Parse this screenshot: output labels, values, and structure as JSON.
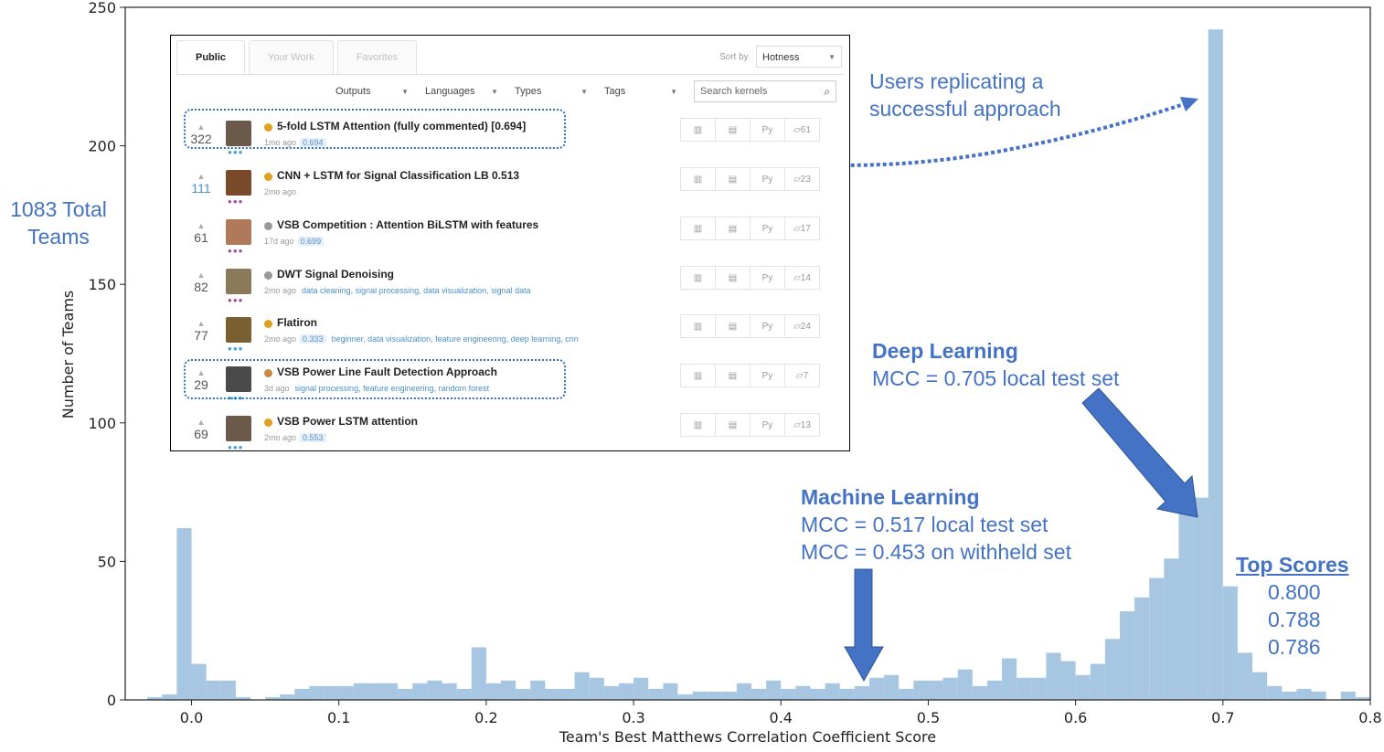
{
  "chart_data": {
    "type": "bar",
    "xlabel": "Team's Best Matthews Correlation Coefficient Score",
    "ylabel": "Number of Teams",
    "xlim": [
      -0.045,
      0.8
    ],
    "ylim": [
      0,
      250
    ],
    "bin_width": 0.01,
    "color": "#A6C6E2",
    "x_ticks": [
      "0.0",
      "0.1",
      "0.2",
      "0.3",
      "0.4",
      "0.5",
      "0.6",
      "0.7",
      "0.8"
    ],
    "y_ticks": [
      "0",
      "50",
      "100",
      "150",
      "200",
      "250"
    ],
    "bin_starts": [
      -0.03,
      -0.02,
      -0.01,
      0.0,
      0.01,
      0.02,
      0.03,
      0.04,
      0.05,
      0.06,
      0.07,
      0.08,
      0.09,
      0.1,
      0.11,
      0.12,
      0.13,
      0.14,
      0.15,
      0.16,
      0.17,
      0.18,
      0.19,
      0.2,
      0.21,
      0.22,
      0.23,
      0.24,
      0.25,
      0.26,
      0.27,
      0.28,
      0.29,
      0.3,
      0.31,
      0.32,
      0.33,
      0.34,
      0.35,
      0.36,
      0.37,
      0.38,
      0.39,
      0.4,
      0.41,
      0.42,
      0.43,
      0.44,
      0.45,
      0.46,
      0.47,
      0.48,
      0.49,
      0.5,
      0.51,
      0.52,
      0.53,
      0.54,
      0.55,
      0.56,
      0.57,
      0.58,
      0.59,
      0.6,
      0.61,
      0.62,
      0.63,
      0.64,
      0.65,
      0.66,
      0.67,
      0.68,
      0.69,
      0.7,
      0.71,
      0.72,
      0.73,
      0.74,
      0.75,
      0.76,
      0.77,
      0.78,
      0.79
    ],
    "values": [
      1,
      2,
      62,
      13,
      7,
      7,
      1,
      0,
      1,
      2,
      4,
      5,
      5,
      5,
      6,
      6,
      6,
      4,
      6,
      7,
      6,
      4,
      19,
      6,
      7,
      4,
      7,
      4,
      4,
      10,
      8,
      5,
      6,
      8,
      4,
      6,
      2,
      3,
      3,
      3,
      6,
      4,
      7,
      4,
      5,
      4,
      6,
      4,
      5,
      8,
      9,
      4,
      7,
      7,
      8,
      11,
      5,
      7,
      15,
      8,
      8,
      17,
      14,
      9,
      13,
      22,
      32,
      37,
      44,
      51,
      70,
      73,
      242,
      41,
      17,
      10,
      5,
      3,
      4,
      3,
      0,
      3,
      1
    ]
  },
  "axes": {
    "x_ticks": [
      "0.0",
      "0.1",
      "0.2",
      "0.3",
      "0.4",
      "0.5",
      "0.6",
      "0.7",
      "0.8"
    ],
    "y_ticks": [
      "0",
      "50",
      "100",
      "150",
      "200",
      "250"
    ],
    "xlabel": "Team's Best Matthews Correlation Coefficient Score",
    "ylabel": "Number of Teams"
  },
  "annotations": {
    "total_teams": "1083 Total Teams",
    "replicating": "Users replicating a successful approach",
    "deep_learning_title": "Deep Learning",
    "deep_learning_mcc": "MCC = 0.705 local test set",
    "ml_title": "Machine Learning",
    "ml_mcc_local": "MCC = 0.517 local test set",
    "ml_mcc_withheld": "MCC = 0.453 on withheld set",
    "top_scores_title": "Top Scores",
    "top_scores": [
      "0.800",
      "0.788",
      "0.786"
    ],
    "accent_color": "#4472C4",
    "arrow_color": "#4472C4"
  },
  "inset": {
    "tabs": [
      "Public",
      "Your Work",
      "Favorites"
    ],
    "sort_label": "Sort by",
    "sort_value": "Hotness",
    "filters": [
      "Outputs",
      "Languages",
      "Types",
      "Tags"
    ],
    "search_placeholder": "Search kernels",
    "rows": [
      {
        "votes": "322",
        "title": "5-fold LSTM Attention (fully commented) [0.694]",
        "age": "1mo ago",
        "score": "0.694",
        "tags": "",
        "lang": "Py",
        "comments": "61"
      },
      {
        "votes": "111",
        "title": "CNN + LSTM for Signal Classification LB 0.513",
        "age": "2mo ago",
        "score": "",
        "tags": "",
        "lang": "Py",
        "comments": "23"
      },
      {
        "votes": "61",
        "title": "VSB Competition : Attention BiLSTM with features",
        "age": "17d ago",
        "score": "0.699",
        "tags": "",
        "lang": "Py",
        "comments": "17"
      },
      {
        "votes": "82",
        "title": "DWT Signal Denoising",
        "age": "2mo ago",
        "score": "",
        "tags": "data cleaning, signal processing, data visualization, signal data",
        "lang": "Py",
        "comments": "14"
      },
      {
        "votes": "77",
        "title": "Flatiron",
        "age": "2mo ago",
        "score": "0.333",
        "tags": "beginner, data visualization, feature engineering, deep learning, cnn",
        "lang": "Py",
        "comments": "24"
      },
      {
        "votes": "29",
        "title": "VSB Power Line Fault Detection Approach",
        "age": "3d ago",
        "score": "",
        "tags": "signal processing, feature engineering, random forest",
        "lang": "Py",
        "comments": "7"
      },
      {
        "votes": "69",
        "title": "VSB Power LSTM attention",
        "age": "2mo ago",
        "score": "0.553",
        "tags": "",
        "lang": "Py",
        "comments": "13"
      }
    ]
  }
}
